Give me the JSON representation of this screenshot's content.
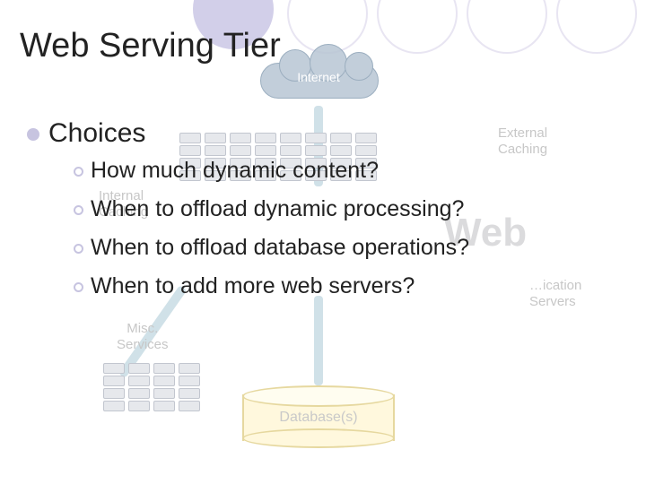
{
  "slide": {
    "title": "Web Serving Tier",
    "level1": "Choices",
    "sub": [
      "How much dynamic content?",
      "When to offload dynamic processing?",
      "When to offload database operations?",
      "When to add more web servers?"
    ]
  },
  "bg": {
    "cloud": "Internet",
    "external": "External\nCaching",
    "internal": "Internal\nCaching",
    "misc": "Misc.\nServices",
    "web": "Web",
    "appservers": "…ication\nServers",
    "db": "Database(s)"
  }
}
